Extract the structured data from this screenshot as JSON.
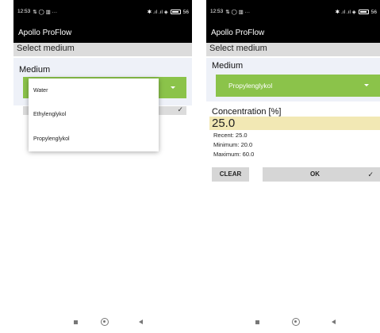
{
  "left": {
    "status_bar": {
      "time": "12:53",
      "left_icons": "⇅ ◯ ▥ ···",
      "right_icons": "✱ .ıl .ıl ◈",
      "battery": "56"
    },
    "app_title": "Apollo ProFlow",
    "section_title": "Select medium",
    "medium_label": "Medium",
    "dropdown_options": [
      "Water",
      "Ethylenglykol",
      "Propylenglykol"
    ],
    "hidden_check": "✓"
  },
  "right": {
    "status_bar": {
      "time": "12:53",
      "left_icons": "⇅ ◯ ▥ ···",
      "right_icons": "✱ .ıl .ıl ◈",
      "battery": "56"
    },
    "app_title": "Apollo ProFlow",
    "section_title": "Select medium",
    "medium_label": "Medium",
    "selected_medium": "Propylenglykol",
    "concentration_label": "Concentration [%]",
    "concentration_value": "25.0",
    "recent": "Recent: 25.0",
    "minimum": "Minimum: 20.0",
    "maximum": "Maximum: 60.0",
    "clear_label": "CLEAR",
    "ok_label": "OK",
    "ok_check": "✓"
  },
  "colors": {
    "accent_green": "#8bc34a",
    "value_highlight": "#f2e8b4",
    "section_gray": "#dcdcdc"
  },
  "icons": {
    "nav": [
      "recent-apps-square-icon",
      "home-circle-icon",
      "back-triangle-icon"
    ]
  }
}
